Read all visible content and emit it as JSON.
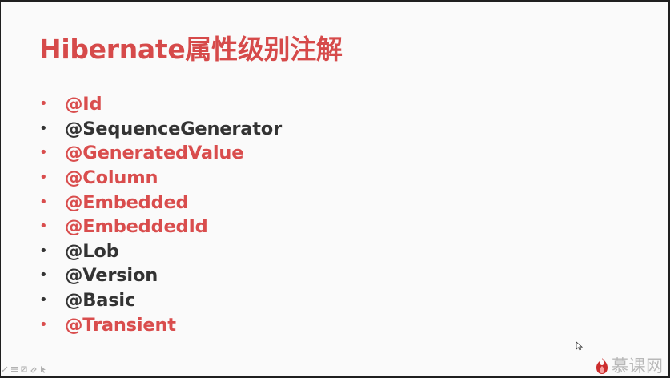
{
  "slide": {
    "title": "Hibernate属性级别注解",
    "items": [
      {
        "text": "@Id",
        "highlight": true
      },
      {
        "text": "@SequenceGenerator",
        "highlight": false
      },
      {
        "text": "@GeneratedValue",
        "highlight": true
      },
      {
        "text": "@Column",
        "highlight": true
      },
      {
        "text": "@Embedded",
        "highlight": true
      },
      {
        "text": "@EmbeddedId",
        "highlight": true
      },
      {
        "text": "@Lob",
        "highlight": false
      },
      {
        "text": "@Version",
        "highlight": false
      },
      {
        "text": "@Basic",
        "highlight": false
      },
      {
        "text": "@Transient",
        "highlight": true
      }
    ]
  },
  "logo": {
    "text": "慕课网",
    "icon": "flame-logo"
  },
  "toolbar": {
    "icons": [
      "pen-icon",
      "menu-icon",
      "edit-icon",
      "eraser-icon",
      "pointer-icon"
    ]
  },
  "colors": {
    "accent_red": "#d94d4d",
    "text_dark": "#333333",
    "slide_background": "#fafafa",
    "frame_background": "#1f1f1f"
  }
}
